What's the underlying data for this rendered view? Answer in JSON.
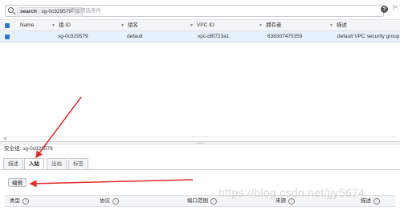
{
  "search": {
    "chip_key": "search",
    "chip_value": "sg-0c929579",
    "chip_close": "×",
    "add_filter_placeholder": "添加筛选条件"
  },
  "toolbar": {
    "help": "?",
    "first_page": "|<"
  },
  "table": {
    "columns": [
      "Name",
      "组 ID",
      "组名",
      "VPC ID",
      "拥有者",
      "描述"
    ],
    "rows": [
      {
        "name": "",
        "group_id": "sg-0c929579",
        "group_name": "default",
        "vpc_id": "vpc-d8f723a1",
        "owner": "638307475359",
        "description": "default VPC security group"
      }
    ]
  },
  "details": {
    "security_group_label": "安全组: sg-0c929579",
    "tabs": [
      "描述",
      "入站",
      "出站",
      "标签"
    ],
    "active_tab": "入站",
    "edit_button": "编辑",
    "rule_columns": [
      "类型",
      "协议",
      "端口范围",
      "来源",
      "描述"
    ]
  },
  "watermark": "https://blog.csdn.net/jjy5674",
  "colors": {
    "accent": "#2e78c8",
    "annotation": "#e02a2a",
    "selected_row": "#e7f1fb"
  }
}
